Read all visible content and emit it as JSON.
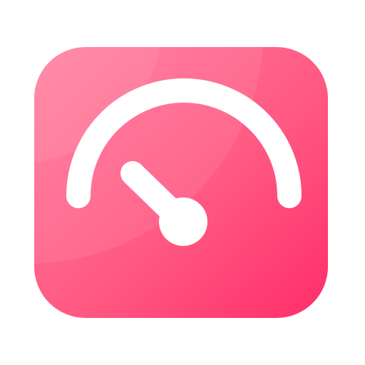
{
  "app_icon": {
    "icon_name": "speedometer-icon",
    "colors": {
      "gradient_light": "#ff7a9b",
      "gradient_mid": "#ff5a83",
      "gradient_dark": "#ff2d6a",
      "glyph": "#ffffff"
    }
  }
}
